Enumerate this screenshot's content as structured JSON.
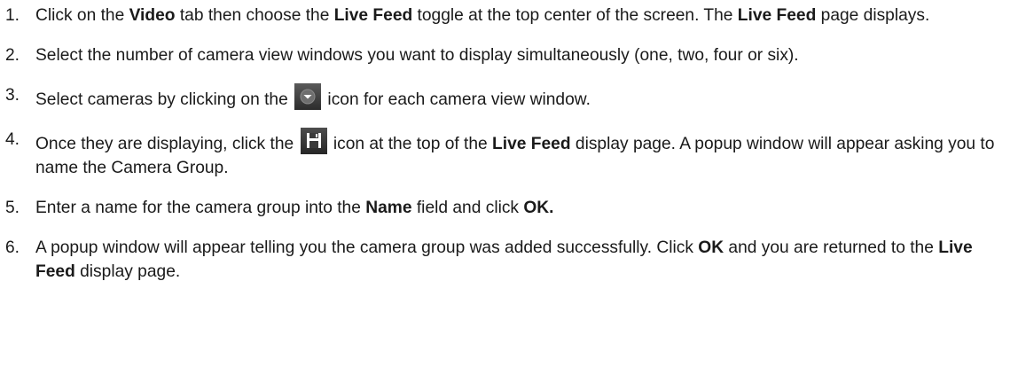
{
  "steps": [
    {
      "number": "1.",
      "parts": [
        "Click on the ",
        "Video",
        " tab then choose the ",
        "Live Feed",
        " toggle at the top center of the screen. The ",
        "Live Feed",
        " page displays."
      ]
    },
    {
      "number": "2.",
      "parts": [
        "Select the number of camera view windows you want to display simultaneously (one, two, four or six)."
      ]
    },
    {
      "number": "3.",
      "parts": [
        "Select cameras by clicking on the ",
        " icon for each camera view window."
      ],
      "icon": "chevron-down-icon"
    },
    {
      "number": "4.",
      "parts": [
        "Once they are displaying, click the ",
        " icon at the top of the ",
        "Live Feed",
        " display page. A popup window will appear asking you to name the Camera Group."
      ],
      "icon": "save-icon"
    },
    {
      "number": "5.",
      "parts": [
        "Enter a name for the camera group into the ",
        "Name",
        " field and click ",
        "OK."
      ]
    },
    {
      "number": "6.",
      "parts": [
        "A popup window will appear telling you the camera group was added successfully.  Click ",
        "OK",
        " and you are returned to the ",
        "Live Feed",
        " display page."
      ]
    }
  ],
  "colors": {
    "text": "#1a1a1a",
    "icon_bg": "#3f3f3f",
    "icon_fg": "#ffffff"
  }
}
